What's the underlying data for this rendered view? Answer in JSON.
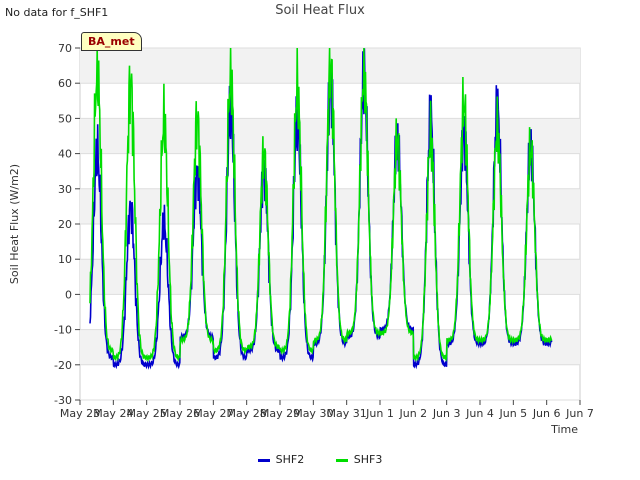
{
  "header": {
    "nodata_text": "No data for f_SHF1",
    "badge_text": "BA_met"
  },
  "chart_data": {
    "type": "line",
    "title": "Soil Heat Flux",
    "xlabel": "Time",
    "ylabel": "Soil Heat Flux (W/m2)",
    "ylim": [
      -30,
      70
    ],
    "yticks": [
      -30,
      -20,
      -10,
      0,
      10,
      20,
      30,
      40,
      50,
      60,
      70
    ],
    "xlim_days": [
      0,
      15
    ],
    "xtick_labels": [
      "May 23",
      "May 24",
      "May 25",
      "May 26",
      "May 27",
      "May 28",
      "May 29",
      "May 30",
      "May 31",
      "Jun 1",
      "Jun 2",
      "Jun 3",
      "Jun 4",
      "Jun 5",
      "Jun 6",
      "Jun 7"
    ],
    "data_start_day": 0.3,
    "data_end_day": 14.15,
    "grid": true,
    "legend_position": "bottom-center",
    "series": [
      {
        "name": "SHF2",
        "color": "#0000cc",
        "daily_max": [
          40,
          25,
          20,
          35,
          53,
          36,
          50,
          61,
          62,
          45,
          50,
          46,
          53,
          42
        ],
        "daily_min": [
          -18,
          -20,
          -20,
          -12,
          -18,
          -16,
          -18,
          -14,
          -12,
          -10,
          -20,
          -14,
          -14,
          -14
        ]
      },
      {
        "name": "SHF3",
        "color": "#00dd00",
        "daily_max": [
          63,
          60,
          49,
          50,
          62,
          40,
          58,
          65,
          63,
          44,
          45,
          54,
          47,
          41
        ],
        "daily_min": [
          -16,
          -18,
          -18,
          -13,
          -16,
          -15,
          -16,
          -13,
          -11,
          -11,
          -18,
          -13,
          -13,
          -13
        ]
      }
    ]
  }
}
